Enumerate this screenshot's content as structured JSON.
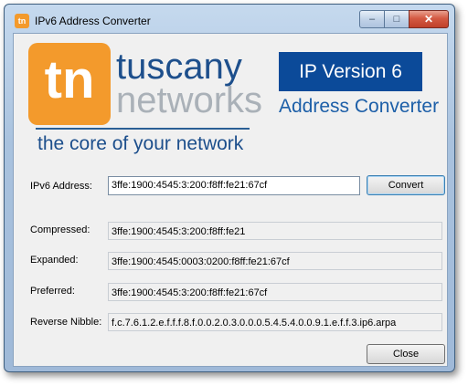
{
  "window": {
    "title": "IPv6 Address Converter",
    "app_icon_text": "tn"
  },
  "caption_buttons": {
    "minimize": "–",
    "maximize": "□",
    "close": "✕"
  },
  "branding": {
    "logo_letters": "tn",
    "company_line1": "tuscany",
    "company_line2": "networks",
    "tagline": "the core of your network",
    "product_badge": "IP Version 6",
    "product_name": "Address Converter"
  },
  "form": {
    "ipv6_label": "IPv6 Address:",
    "ipv6_value": "3ffe:1900:4545:3:200:f8ff:fe21:67cf",
    "convert_label": "Convert",
    "compressed_label": "Compressed:",
    "compressed_value": "3ffe:1900:4545:3:200:f8ff:fe21",
    "expanded_label": "Expanded:",
    "expanded_value": "3ffe:1900:4545:0003:0200:f8ff:fe21:67cf",
    "preferred_label": "Preferred:",
    "preferred_value": "3ffe:1900:4545:3:200:f8ff:fe21:67cf",
    "reverse_label": "Reverse Nibble:",
    "reverse_value": "f.c.7.6.1.2.e.f.f.f.8.f.0.0.2.0.3.0.0.0.5.4.5.4.0.0.9.1.e.f.f.3.ip6.arpa",
    "close_label": "Close"
  },
  "colors": {
    "brand_orange": "#f39a2c",
    "brand_blue": "#1d4f8c",
    "badge_blue": "#0b4a99"
  }
}
